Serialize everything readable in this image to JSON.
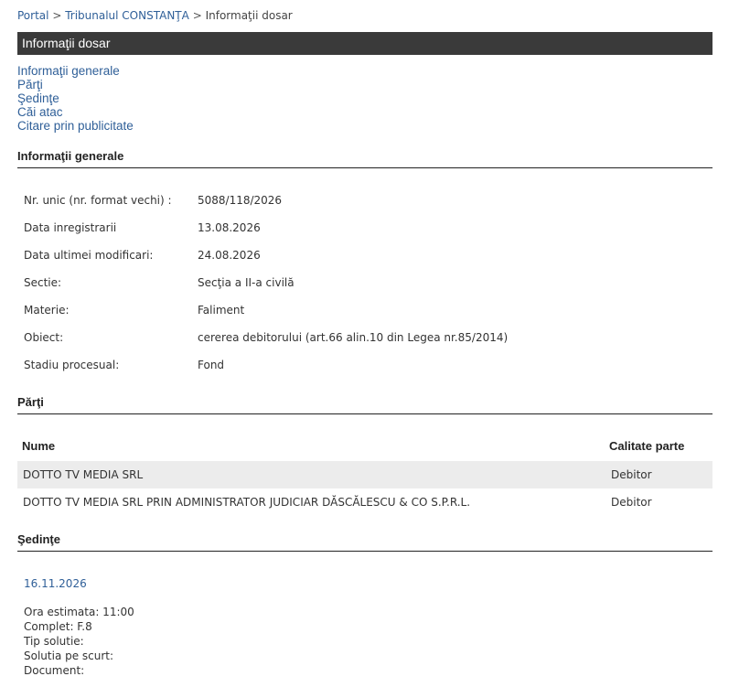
{
  "breadcrumb": {
    "portal": "Portal",
    "sep1": ">",
    "court": "Tribunalul CONSTANŢA",
    "sep2": ">",
    "current": "Informaţii dosar"
  },
  "header": {
    "title": "Informaţii dosar"
  },
  "nav": {
    "links": [
      "Informaţii generale",
      "Părţi",
      "Şedinţe",
      "Căi atac",
      "Citare prin publicitate"
    ]
  },
  "general": {
    "title": "Informaţii generale",
    "rows": [
      {
        "label": "Nr. unic (nr. format vechi) :",
        "value": "5088/118/2026"
      },
      {
        "label": "Data inregistrarii",
        "value": "13.08.2026"
      },
      {
        "label": "Data ultimei modificari:",
        "value": "24.08.2026"
      },
      {
        "label": "Sectie:",
        "value": "Secţia a II-a civilă"
      },
      {
        "label": "Materie:",
        "value": "Faliment"
      },
      {
        "label": "Obiect:",
        "value": "cererea debitorului (art.66 alin.10 din Legea nr.85/2014)"
      },
      {
        "label": "Stadiu procesual:",
        "value": "Fond"
      }
    ]
  },
  "parties": {
    "title": "Părţi",
    "headers": {
      "name": "Nume",
      "role": "Calitate parte"
    },
    "rows": [
      {
        "name": "DOTTO TV MEDIA SRL",
        "role": "Debitor"
      },
      {
        "name": "DOTTO TV MEDIA SRL PRIN ADMINISTRATOR JUDICIAR DĂSCĂLESCU & CO S.P.R.L.",
        "role": "Debitor"
      }
    ]
  },
  "hearings": {
    "title": "Şedinţe",
    "date": "16.11.2026",
    "details": [
      "Ora estimata: 11:00",
      "Complet: F.8",
      "Tip solutie:",
      "Solutia pe scurt:",
      "Document:"
    ]
  },
  "colors": {
    "header_bg": "#3a3a3a",
    "link": "#2f5f98",
    "row_alt": "#ececec"
  }
}
